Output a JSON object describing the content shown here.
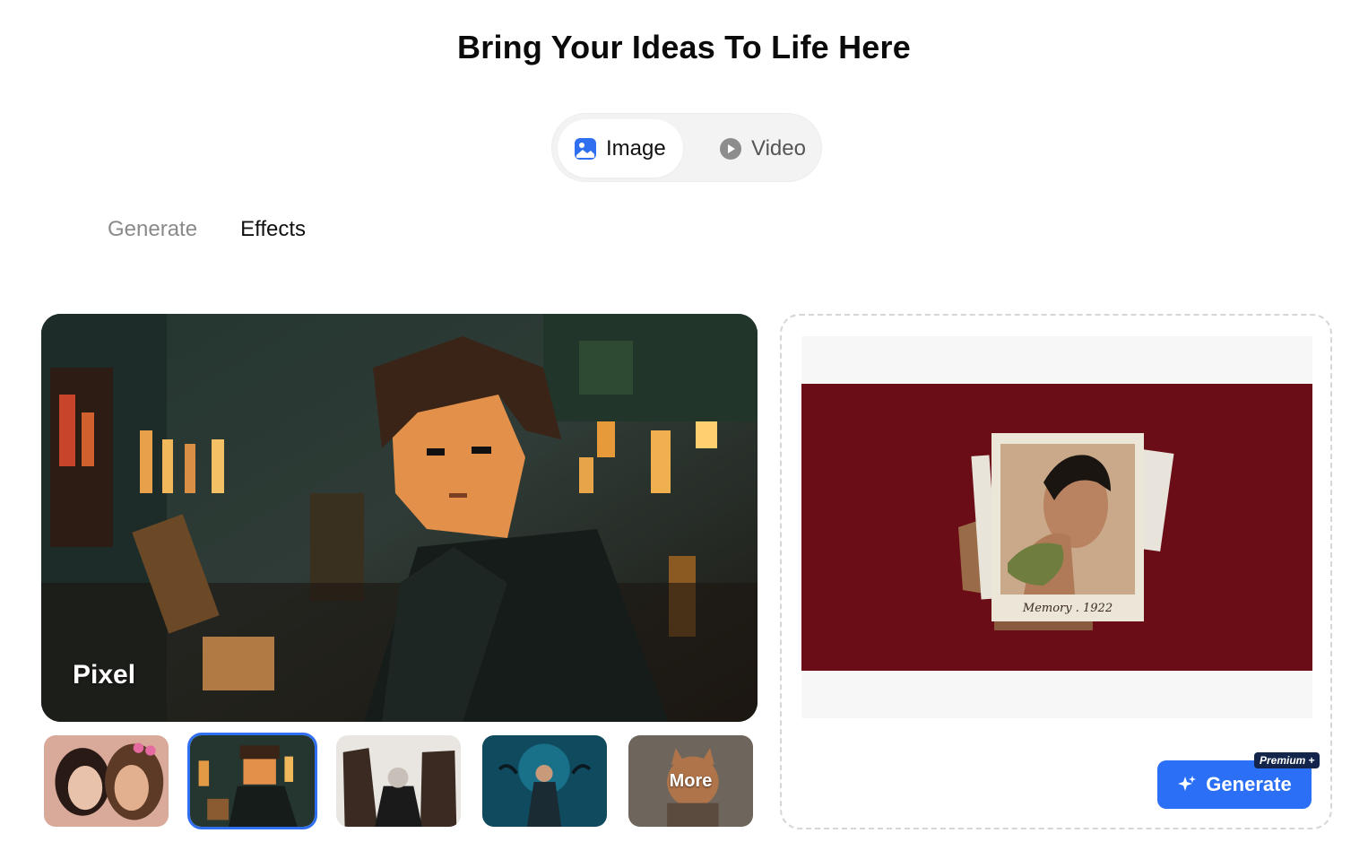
{
  "page": {
    "title": "Bring Your Ideas To Life Here"
  },
  "mode_switch": {
    "image_label": "Image",
    "video_label": "Video",
    "image_icon": "image-icon",
    "video_icon": "play-circle-icon",
    "active": "Image"
  },
  "subtabs": {
    "generate_label": "Generate",
    "effects_label": "Effects",
    "active": "Effects"
  },
  "hero": {
    "effect_label": "Pixel"
  },
  "thumbnails": {
    "items": [
      {
        "name": "couple-selfie"
      },
      {
        "name": "pixel-boy",
        "selected": true
      },
      {
        "name": "dark-creatures"
      },
      {
        "name": "blue-monster"
      },
      {
        "name": "cat-more",
        "label": "More"
      }
    ]
  },
  "preview": {
    "caption": "Memory . 1922"
  },
  "actions": {
    "generate_label": "Generate",
    "generate_icon": "sparkle-icon",
    "premium_badge": "Premium",
    "premium_plus": "+"
  },
  "colors": {
    "accent": "#2a6ff5",
    "preview_bg": "#6a0d16",
    "badge_bg": "#13254a"
  }
}
